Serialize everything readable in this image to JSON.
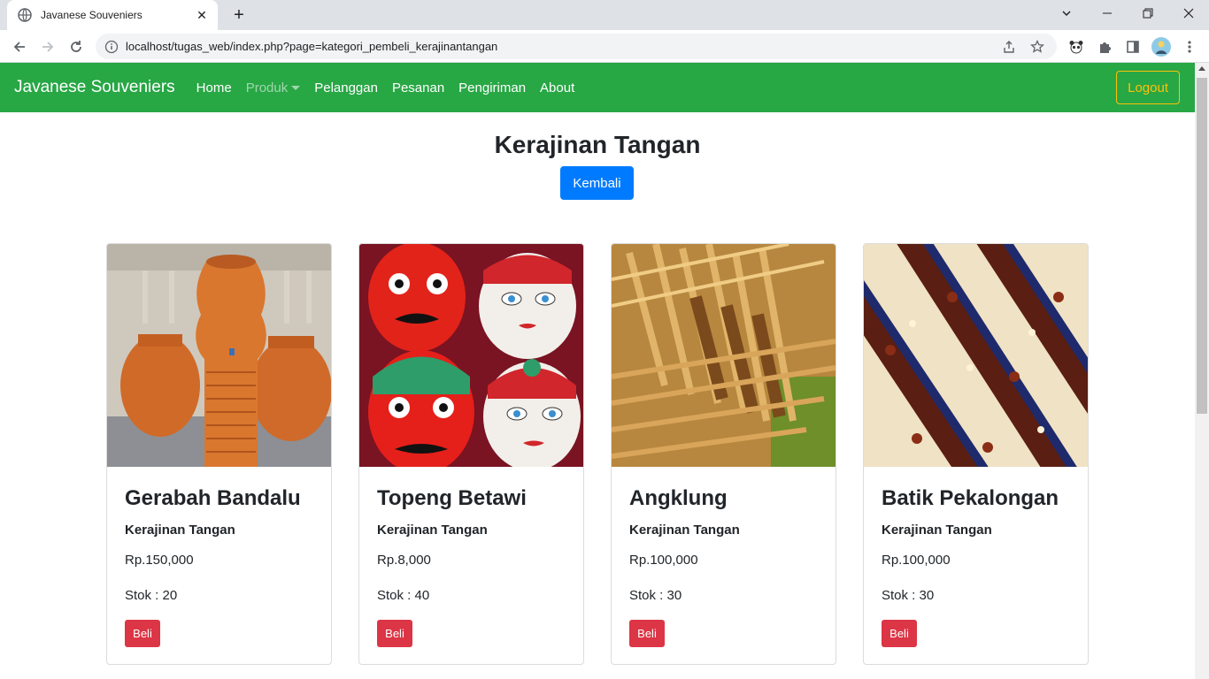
{
  "browser": {
    "tab_title": "Javanese Souveniers",
    "url": "localhost/tugas_web/index.php?page=kategori_pembeli_kerajinantangan"
  },
  "navbar": {
    "brand": "Javanese Souveniers",
    "links": [
      "Home",
      "Produk",
      "Pelanggan",
      "Pesanan",
      "Pengiriman",
      "About"
    ],
    "logout": "Logout"
  },
  "page": {
    "title": "Kerajinan Tangan",
    "back_button": "Kembali"
  },
  "products": [
    {
      "name": "Gerabah Bandalu",
      "category": "Kerajinan Tangan",
      "price": "Rp.150,000",
      "stock": "Stok : 20",
      "buy": "Beli"
    },
    {
      "name": "Topeng Betawi",
      "category": "Kerajinan Tangan",
      "price": "Rp.8,000",
      "stock": "Stok : 40",
      "buy": "Beli"
    },
    {
      "name": "Angklung",
      "category": "Kerajinan Tangan",
      "price": "Rp.100,000",
      "stock": "Stok : 30",
      "buy": "Beli"
    },
    {
      "name": "Batik Pekalongan",
      "category": "Kerajinan Tangan",
      "price": "Rp.100,000",
      "stock": "Stok : 30",
      "buy": "Beli"
    }
  ],
  "colors": {
    "navbar": "#28a745",
    "primary": "#007bff",
    "danger": "#dc3545",
    "warning": "#ffc107"
  }
}
